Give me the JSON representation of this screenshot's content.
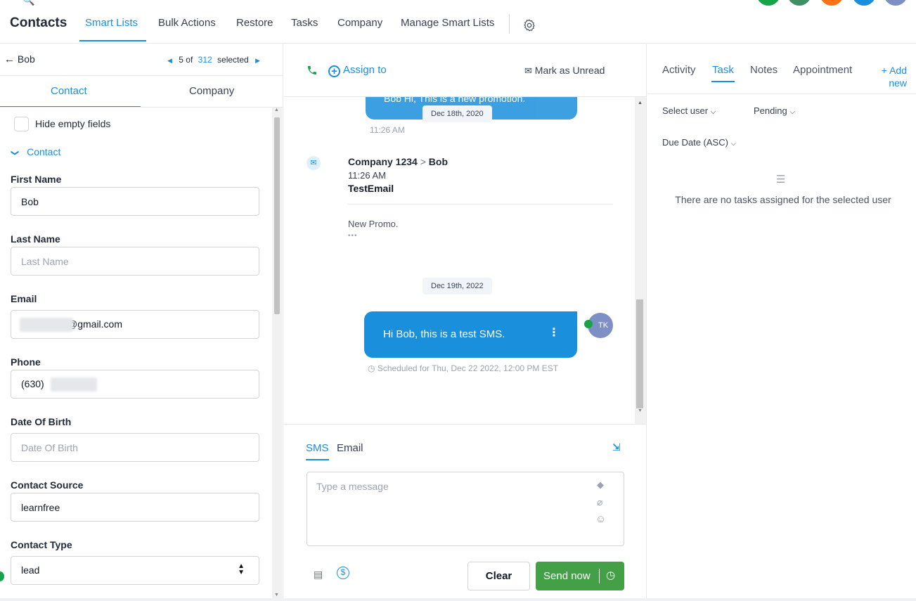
{
  "nav": {
    "title": "Contacts",
    "items": [
      "Smart Lists",
      "Bulk Actions",
      "Restore",
      "Tasks",
      "Company",
      "Manage Smart Lists"
    ],
    "avatar_colors": [
      "#16a34a",
      "#3f8f62",
      "#f97316",
      "#1a8fdc",
      "#7d8fc4"
    ]
  },
  "left": {
    "back_label": "Bob",
    "pager_pos": "5",
    "pager_of": "of",
    "pager_total": "312",
    "pager_selected": "selected",
    "tabs": [
      "Contact",
      "Company"
    ],
    "hide_empty": "Hide empty fields",
    "section": "Contact",
    "fields": [
      {
        "label": "First Name",
        "value": "Bob",
        "placeholder": ""
      },
      {
        "label": "Last Name",
        "value": "",
        "placeholder": "Last Name"
      },
      {
        "label": "Email",
        "value": "@gmail.com",
        "placeholder": ""
      },
      {
        "label": "Phone",
        "value": "(630)",
        "placeholder": ""
      },
      {
        "label": "Date Of Birth",
        "value": "",
        "placeholder": "Date Of Birth"
      },
      {
        "label": "Contact Source",
        "value": "learnfree",
        "placeholder": ""
      },
      {
        "label": "Contact Type",
        "value": "lead",
        "placeholder": ""
      }
    ]
  },
  "middle": {
    "assign": "Assign to",
    "mark_unread": "Mark as Unread",
    "bubble_top": "Bob Hi, This is a new promotion.",
    "date1": "Dec 18th, 2020",
    "time1": "11:26 AM",
    "email_from": "Company 1234",
    "email_sep": ">",
    "email_to": "Bob",
    "email_time": "11:26 AM",
    "email_subject": "TestEmail",
    "email_body": "New Promo.",
    "email_more": "•••",
    "date2": "Dec 19th, 2022",
    "sms_text": "Hi Bob, this is a test SMS.",
    "avatar_initials": "TK",
    "scheduled": "Scheduled for Thu, Dec 22 2022, 12:00 PM EST",
    "compose_tabs": [
      "SMS",
      "Email"
    ],
    "placeholder": "Type a message",
    "clear": "Clear",
    "send": "Send now"
  },
  "right": {
    "tabs": [
      "Activity",
      "Task",
      "Notes",
      "Appointment"
    ],
    "add_new": "+ Add new",
    "select_user": "Select user",
    "pending": "Pending",
    "due_date": "Due Date (ASC)",
    "empty": "There are no tasks assigned for the selected user"
  }
}
